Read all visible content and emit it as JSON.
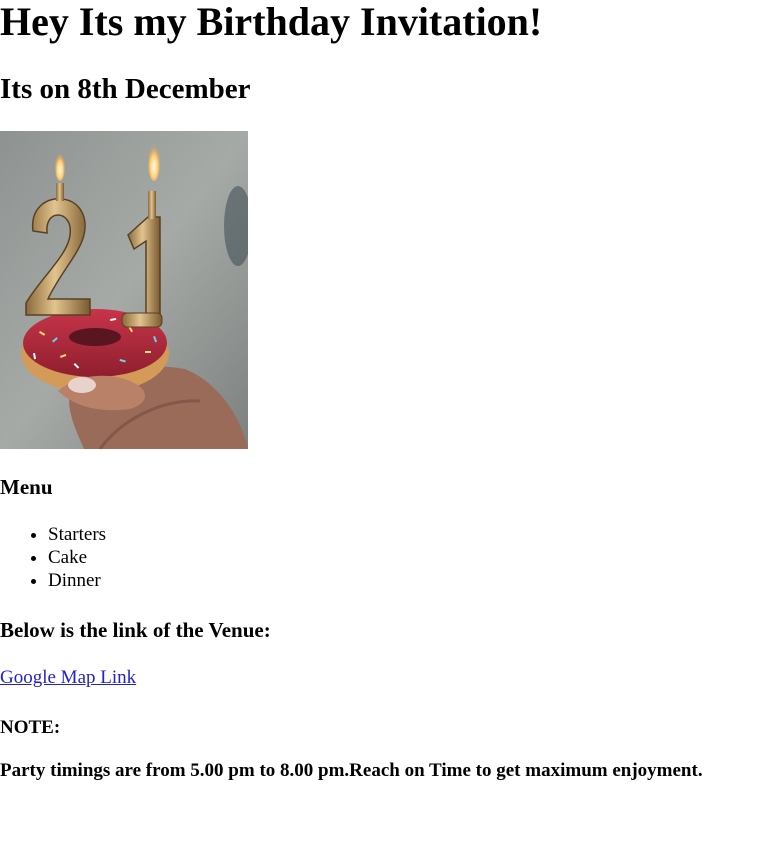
{
  "page": {
    "title": "Hey Its my Birthday Invitation!",
    "subtitle": "Its on 8th December"
  },
  "photo": {
    "subject": "21 number candles on a sprinkled donut",
    "digits": "21"
  },
  "menu": {
    "heading": "Menu",
    "items": [
      "Starters",
      "Cake",
      "Dinner"
    ]
  },
  "venue": {
    "heading": "Below is the link of the Venue:",
    "link_label": "Google Map Link"
  },
  "note": {
    "heading": "NOTE:",
    "text": "Party timings are from 5.00 pm to 8.00 pm.Reach on Time to get maximum enjoyment."
  },
  "colors": {
    "link": "#2222cc",
    "text": "#000000",
    "background": "#ffffff"
  }
}
